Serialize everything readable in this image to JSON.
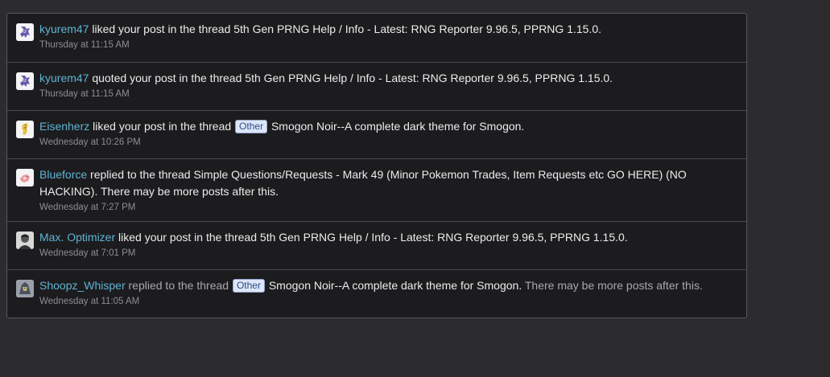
{
  "alerts": [
    {
      "user": "kyurem47",
      "action": "liked your post in the thread",
      "prefix": "",
      "thread": "5th Gen PRNG Help / Info - Latest: RNG Reporter 9.96.5, PPRNG 1.15.0.",
      "suffix": "",
      "time": "Thursday at 11:15 AM",
      "avatar_icon": "kyurem-sprite-icon"
    },
    {
      "user": "kyurem47",
      "action": "quoted your post in the thread",
      "prefix": "",
      "thread": "5th Gen PRNG Help / Info - Latest: RNG Reporter 9.96.5, PPRNG 1.15.0.",
      "suffix": "",
      "time": "Thursday at 11:15 AM",
      "avatar_icon": "kyurem-sprite-icon"
    },
    {
      "user": "Eisenherz",
      "action": "liked your post in the thread",
      "prefix": "Other",
      "thread": "Smogon Noir--A complete dark theme for Smogon.",
      "suffix": "",
      "time": "Wednesday at 10:26 PM",
      "avatar_icon": "pokemon-sprite-icon"
    },
    {
      "user": "Blueforce",
      "action": "replied to the thread",
      "prefix": "",
      "thread": "Simple Questions/Requests - Mark 49 (Minor Pokemon Trades, Item Requests etc GO HERE) (NO HACKING).",
      "suffix": "There may be more posts after this.",
      "time": "Wednesday at 7:27 PM",
      "avatar_icon": "pokemon-sprite-icon"
    },
    {
      "user": "Max. Optimizer",
      "action": "liked your post in the thread",
      "prefix": "",
      "thread": "5th Gen PRNG Help / Info - Latest: RNG Reporter 9.96.5, PPRNG 1.15.0.",
      "suffix": "",
      "time": "Wednesday at 7:01 PM",
      "avatar_icon": "user-photo-icon"
    },
    {
      "user": "Shoopz_Whisper",
      "action": "replied to the thread",
      "prefix": "Other",
      "thread": "Smogon Noir--A complete dark theme for Smogon.",
      "suffix": "There may be more posts after this.",
      "time": "Wednesday at 11:05 AM",
      "avatar_icon": "pokemon-sprite-icon"
    }
  ],
  "colors": {
    "page_bg": "#2c2c2e",
    "panel_bg": "#1c1c1e",
    "username": "#5fb3d4",
    "text": "#ececec",
    "muted": "#a8a8ac",
    "time": "#8e8e92",
    "prefix_bg": "#dde6f7",
    "prefix_text": "#2f4f8a"
  }
}
